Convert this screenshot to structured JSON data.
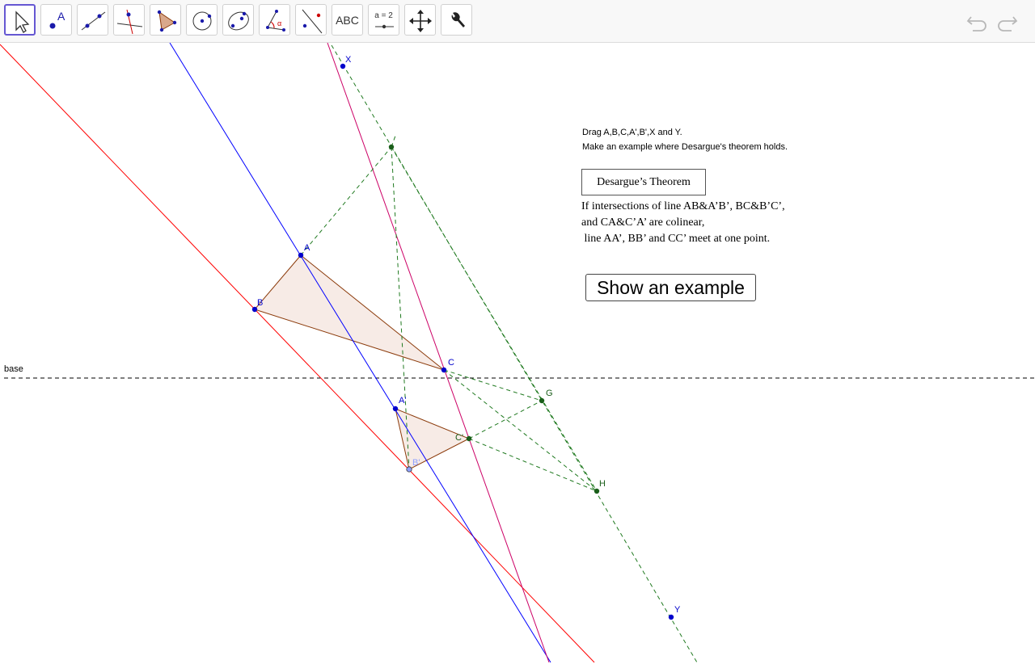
{
  "toolbar": {
    "tools": [
      {
        "name": "move-tool",
        "icon": "arrow-cursor-icon"
      },
      {
        "name": "point-tool",
        "icon": "point-icon",
        "label": "A"
      },
      {
        "name": "line-tool",
        "icon": "line-through-points-icon"
      },
      {
        "name": "perpendicular-line-tool",
        "icon": "perpendicular-line-icon"
      },
      {
        "name": "polygon-tool",
        "icon": "polygon-icon"
      },
      {
        "name": "circle-tool",
        "icon": "circle-center-point-icon"
      },
      {
        "name": "conic-tool",
        "icon": "ellipse-icon"
      },
      {
        "name": "angle-tool",
        "icon": "angle-icon",
        "label": "α"
      },
      {
        "name": "reflect-tool",
        "icon": "reflect-point-icon"
      },
      {
        "name": "text-tool",
        "icon": "text-icon",
        "label": "ABC"
      },
      {
        "name": "slider-tool",
        "icon": "slider-icon",
        "label": "a = 2"
      },
      {
        "name": "move-view-tool",
        "icon": "move-arrows-icon"
      },
      {
        "name": "tools-menu",
        "icon": "wrench-icon"
      }
    ],
    "undo_icon": "undo-icon",
    "redo_icon": "redo-icon"
  },
  "instructions": {
    "line1": "Drag A,B,C,A',B',X and Y.",
    "line2": "Make an example where Desargue's theorem holds."
  },
  "theorem": {
    "title": "Desargue’s Theorem",
    "body": "If intersections of line AB&A’B’, BC&B’C’,\nand CA&C’A’ are colinear,\n line AA’, BB’ and CC’ meet at one point."
  },
  "button": {
    "label": "Show an example"
  },
  "labels": {
    "base": "base",
    "X": "X",
    "Y": "Y",
    "A": "A",
    "B": "B",
    "C": "C",
    "A1": "A'",
    "B1": "B'",
    "C1": "C'",
    "G": "G",
    "H": "H"
  },
  "colors": {
    "accent": "#6557d2",
    "point_blue": "#0000cc",
    "point_green": "#1a5e1a",
    "red_line": "#ff0000",
    "blue_line": "#0000ff",
    "magenta_line": "#cc0066",
    "green_dashed": "#207a20",
    "triangle_fill": "#f3e3dc",
    "triangle_edge": "#8b3a0a"
  }
}
